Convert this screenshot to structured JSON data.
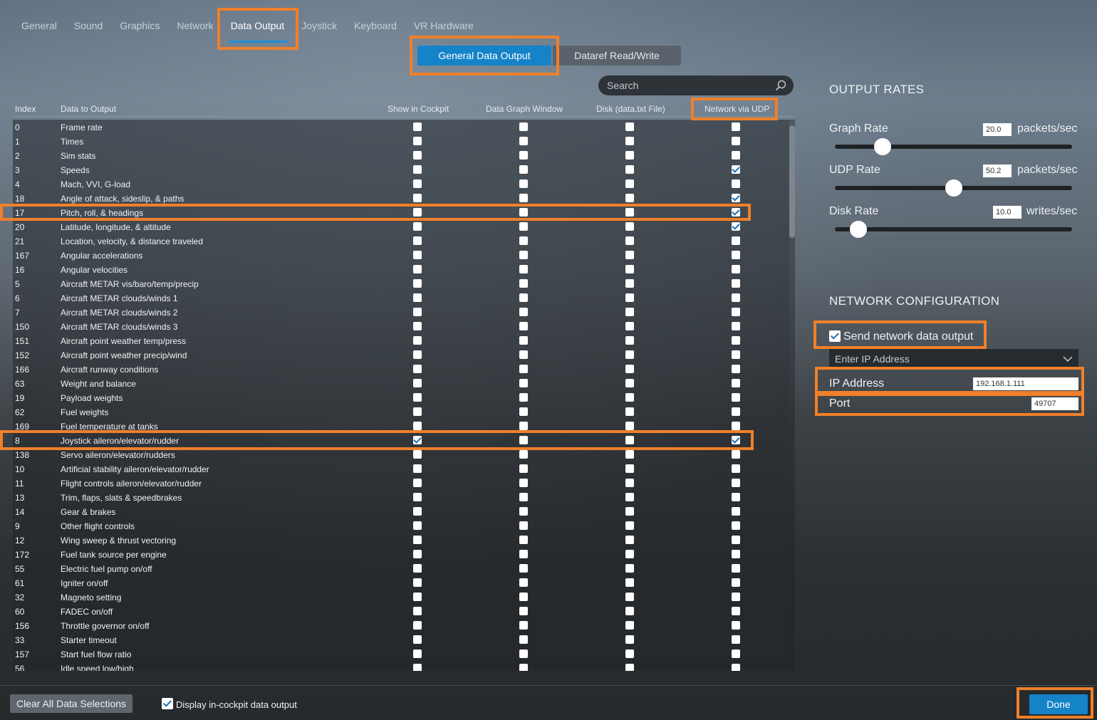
{
  "tabs": [
    "General",
    "Sound",
    "Graphics",
    "Network",
    "Data Output",
    "Joystick",
    "Keyboard",
    "VR Hardware"
  ],
  "active_tab": "Data Output",
  "subtabs": {
    "general": "General Data Output",
    "dataref": "Dataref Read/Write"
  },
  "search": {
    "placeholder": "Search"
  },
  "columns": {
    "index": "Index",
    "data": "Data to Output",
    "cockpit": "Show in Cockpit",
    "graph": "Data Graph Window",
    "disk": "Disk (data.txt File)",
    "udp": "Network via UDP"
  },
  "rows": [
    {
      "idx": "0",
      "name": "Frame rate",
      "cockpit": false,
      "graph": false,
      "disk": false,
      "udp": false
    },
    {
      "idx": "1",
      "name": "Times",
      "cockpit": false,
      "graph": false,
      "disk": false,
      "udp": false
    },
    {
      "idx": "2",
      "name": "Sim stats",
      "cockpit": false,
      "graph": false,
      "disk": false,
      "udp": false
    },
    {
      "idx": "3",
      "name": "Speeds",
      "cockpit": false,
      "graph": false,
      "disk": false,
      "udp": true
    },
    {
      "idx": "4",
      "name": "Mach, VVI, G-load",
      "cockpit": false,
      "graph": false,
      "disk": false,
      "udp": false
    },
    {
      "idx": "18",
      "name": "Angle of attack, sideslip, & paths",
      "cockpit": false,
      "graph": false,
      "disk": false,
      "udp": true
    },
    {
      "idx": "17",
      "name": "Pitch, roll, & headings",
      "cockpit": false,
      "graph": false,
      "disk": false,
      "udp": true
    },
    {
      "idx": "20",
      "name": "Latitude, longitude, & altitude",
      "cockpit": false,
      "graph": false,
      "disk": false,
      "udp": true
    },
    {
      "idx": "21",
      "name": "Location, velocity, & distance traveled",
      "cockpit": false,
      "graph": false,
      "disk": false,
      "udp": false
    },
    {
      "idx": "167",
      "name": "Angular accelerations",
      "cockpit": false,
      "graph": false,
      "disk": false,
      "udp": false
    },
    {
      "idx": "16",
      "name": "Angular velocities",
      "cockpit": false,
      "graph": false,
      "disk": false,
      "udp": false
    },
    {
      "idx": "5",
      "name": "Aircraft METAR vis/baro/temp/precip",
      "cockpit": false,
      "graph": false,
      "disk": false,
      "udp": false
    },
    {
      "idx": "6",
      "name": "Aircraft METAR clouds/winds 1",
      "cockpit": false,
      "graph": false,
      "disk": false,
      "udp": false
    },
    {
      "idx": "7",
      "name": "Aircraft METAR clouds/winds 2",
      "cockpit": false,
      "graph": false,
      "disk": false,
      "udp": false
    },
    {
      "idx": "150",
      "name": "Aircraft METAR clouds/winds 3",
      "cockpit": false,
      "graph": false,
      "disk": false,
      "udp": false
    },
    {
      "idx": "151",
      "name": "Aircraft point weather temp/press",
      "cockpit": false,
      "graph": false,
      "disk": false,
      "udp": false
    },
    {
      "idx": "152",
      "name": "Aircraft point weather precip/wind",
      "cockpit": false,
      "graph": false,
      "disk": false,
      "udp": false
    },
    {
      "idx": "166",
      "name": "Aircraft runway conditions",
      "cockpit": false,
      "graph": false,
      "disk": false,
      "udp": false
    },
    {
      "idx": "63",
      "name": "Weight and balance",
      "cockpit": false,
      "graph": false,
      "disk": false,
      "udp": false
    },
    {
      "idx": "19",
      "name": "Payload weights",
      "cockpit": false,
      "graph": false,
      "disk": false,
      "udp": false
    },
    {
      "idx": "62",
      "name": "Fuel weights",
      "cockpit": false,
      "graph": false,
      "disk": false,
      "udp": false
    },
    {
      "idx": "169",
      "name": "Fuel temperature at tanks",
      "cockpit": false,
      "graph": false,
      "disk": false,
      "udp": false
    },
    {
      "idx": "8",
      "name": "Joystick aileron/elevator/rudder",
      "cockpit": true,
      "graph": false,
      "disk": false,
      "udp": true
    },
    {
      "idx": "138",
      "name": "Servo aileron/elevator/rudders",
      "cockpit": false,
      "graph": false,
      "disk": false,
      "udp": false
    },
    {
      "idx": "10",
      "name": "Artificial stability aileron/elevator/rudder",
      "cockpit": false,
      "graph": false,
      "disk": false,
      "udp": false
    },
    {
      "idx": "11",
      "name": "Flight controls aileron/elevator/rudder",
      "cockpit": false,
      "graph": false,
      "disk": false,
      "udp": false
    },
    {
      "idx": "13",
      "name": "Trim, flaps, slats & speedbrakes",
      "cockpit": false,
      "graph": false,
      "disk": false,
      "udp": false
    },
    {
      "idx": "14",
      "name": "Gear & brakes",
      "cockpit": false,
      "graph": false,
      "disk": false,
      "udp": false
    },
    {
      "idx": "9",
      "name": "Other flight controls",
      "cockpit": false,
      "graph": false,
      "disk": false,
      "udp": false
    },
    {
      "idx": "12",
      "name": "Wing sweep & thrust vectoring",
      "cockpit": false,
      "graph": false,
      "disk": false,
      "udp": false
    },
    {
      "idx": "172",
      "name": "Fuel tank source per engine",
      "cockpit": false,
      "graph": false,
      "disk": false,
      "udp": false
    },
    {
      "idx": "55",
      "name": "Electric fuel pump on/off",
      "cockpit": false,
      "graph": false,
      "disk": false,
      "udp": false
    },
    {
      "idx": "61",
      "name": "Igniter on/off",
      "cockpit": false,
      "graph": false,
      "disk": false,
      "udp": false
    },
    {
      "idx": "32",
      "name": "Magneto setting",
      "cockpit": false,
      "graph": false,
      "disk": false,
      "udp": false
    },
    {
      "idx": "60",
      "name": "FADEC on/off",
      "cockpit": false,
      "graph": false,
      "disk": false,
      "udp": false
    },
    {
      "idx": "156",
      "name": "Throttle governor on/off",
      "cockpit": false,
      "graph": false,
      "disk": false,
      "udp": false
    },
    {
      "idx": "33",
      "name": "Starter timeout",
      "cockpit": false,
      "graph": false,
      "disk": false,
      "udp": false
    },
    {
      "idx": "157",
      "name": "Start fuel flow ratio",
      "cockpit": false,
      "graph": false,
      "disk": false,
      "udp": false
    },
    {
      "idx": "56",
      "name": "Idle speed low/high",
      "cockpit": false,
      "graph": false,
      "disk": false,
      "udp": false
    }
  ],
  "output_rates": {
    "title": "OUTPUT RATES",
    "graph": {
      "label": "Graph Rate",
      "value": "20.0",
      "unit": "packets/sec",
      "level": 0.2
    },
    "udp": {
      "label": "UDP Rate",
      "value": "50.2",
      "unit": "packets/sec",
      "level": 0.5
    },
    "disk": {
      "label": "Disk Rate",
      "value": "10.0",
      "unit": "writes/sec",
      "level": 0.1
    }
  },
  "network": {
    "title": "NETWORK CONFIGURATION",
    "send_label": "Send network data output",
    "send_checked": true,
    "ip_dropdown": "Enter IP Address",
    "ip_label": "IP Address",
    "ip_value": "192.168.1.111",
    "port_label": "Port",
    "port_value": "49707"
  },
  "footer": {
    "clear_label": "Clear All Data Selections",
    "display_label": "Display in-cockpit data output",
    "display_checked": true,
    "done_label": "Done"
  }
}
